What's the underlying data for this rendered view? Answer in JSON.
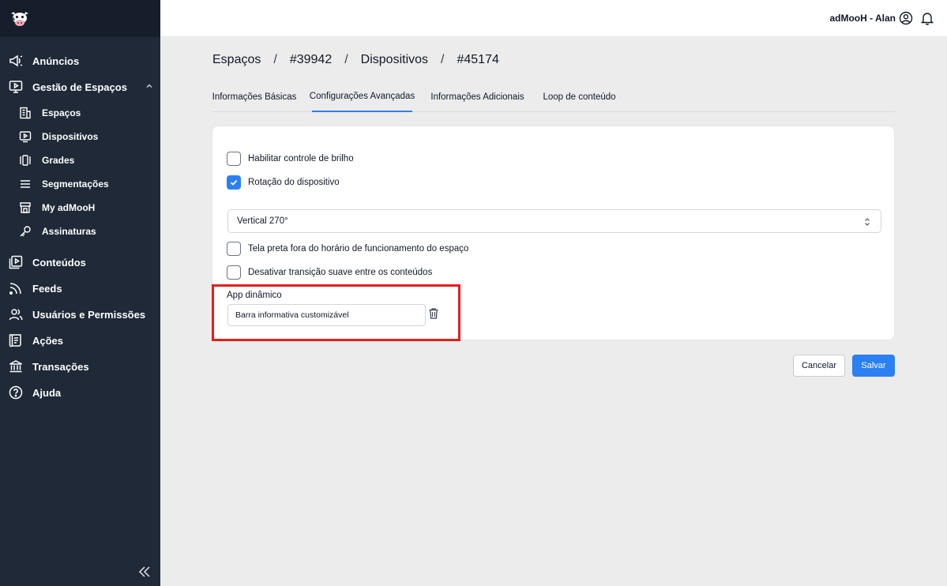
{
  "header": {
    "user_name": "adMooH - Alan"
  },
  "sidebar": {
    "items": [
      {
        "label": "Anúncios",
        "icon": "megaphone-icon"
      },
      {
        "label": "Gestão de Espaços",
        "icon": "screen-play-icon",
        "expanded": true
      },
      {
        "label": "Conteúdos",
        "icon": "media-library-icon"
      },
      {
        "label": "Feeds",
        "icon": "rss-icon"
      },
      {
        "label": "Usuários e Permissões",
        "icon": "users-icon"
      },
      {
        "label": "Ações",
        "icon": "receipt-icon"
      },
      {
        "label": "Transações",
        "icon": "bank-icon"
      },
      {
        "label": "Ajuda",
        "icon": "help-circle-icon"
      }
    ],
    "sub_items": [
      {
        "label": "Espaços",
        "icon": "building-icon"
      },
      {
        "label": "Dispositivos",
        "icon": "device-icon"
      },
      {
        "label": "Grades",
        "icon": "columns-icon"
      },
      {
        "label": "Segmentações",
        "icon": "menu-lines-icon"
      },
      {
        "label": "My adMooH",
        "icon": "store-icon"
      },
      {
        "label": "Assinaturas",
        "icon": "key-icon"
      }
    ]
  },
  "breadcrumb": [
    "Espaços",
    "#39942",
    "Dispositivos",
    "#45174"
  ],
  "tabs": [
    {
      "label": "Informações Básicas",
      "active": false
    },
    {
      "label": "Configurações Avançadas",
      "active": true
    },
    {
      "label": "Informações Adicionais",
      "active": false
    },
    {
      "label": "Loop de conteúdo",
      "active": false
    }
  ],
  "form": {
    "brightness_label": "Habilitar controle de brilho",
    "brightness_checked": false,
    "rotation_label": "Rotação do dispositivo",
    "rotation_checked": true,
    "rotation_value": "Vertical 270°",
    "black_screen_label": "Tela preta fora do horário de funcionamento do espaço",
    "black_screen_checked": false,
    "transition_label": "Desativar transição suave entre os conteúdos",
    "transition_checked": false,
    "app_label": "App dinâmico",
    "app_value": "Barra informativa customizável"
  },
  "actions": {
    "cancel": "Cancelar",
    "save": "Salvar"
  },
  "colors": {
    "accent": "#2b80f2",
    "sidebar_bg": "#1f2937",
    "highlight": "#e3201b"
  }
}
